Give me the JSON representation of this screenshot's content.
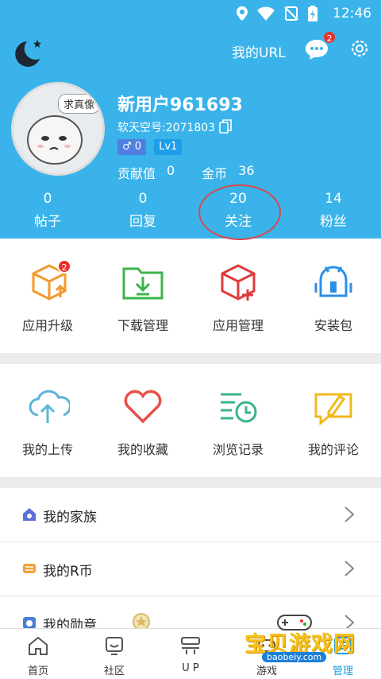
{
  "status_bar": {
    "time": "12:46"
  },
  "header": {
    "my_url_label": "我的URL",
    "message_badge": "2",
    "avatar_bubble_text": "求真像",
    "username": "新用户961693",
    "uid_text": "软天空号:2071803",
    "gender_count": "0",
    "level": "Lv1",
    "contribution_label": "贡献值",
    "contribution_value": "0",
    "coins_label": "金币",
    "coins_value": "36",
    "stats": [
      {
        "num": "0",
        "label": "帖子"
      },
      {
        "num": "0",
        "label": "回复"
      },
      {
        "num": "20",
        "label": "关注"
      },
      {
        "num": "14",
        "label": "粉丝"
      }
    ]
  },
  "grid1": [
    {
      "label": "应用升级",
      "icon": "box-upload-icon",
      "badge": "2",
      "color": "#f39a2c"
    },
    {
      "label": "下载管理",
      "icon": "folder-download-icon",
      "color": "#3cb34a"
    },
    {
      "label": "应用管理",
      "icon": "box-add-icon",
      "color": "#e03a3a"
    },
    {
      "label": "安装包",
      "icon": "android-package-icon",
      "color": "#2b8fe8"
    }
  ],
  "grid2": [
    {
      "label": "我的上传",
      "icon": "cloud-upload-icon",
      "color": "#5ab5d8"
    },
    {
      "label": "我的收藏",
      "icon": "heart-icon",
      "color": "#e8504c"
    },
    {
      "label": "浏览记录",
      "icon": "history-list-icon",
      "color": "#37b48a"
    },
    {
      "label": "我的评论",
      "icon": "comment-edit-icon",
      "color": "#f2b81c"
    }
  ],
  "list": [
    {
      "label": "我的家族",
      "icon": "family-house-icon",
      "color": "#5b6fd6"
    },
    {
      "label": "我的R币",
      "icon": "coin-stack-icon",
      "color": "#f3a23a"
    },
    {
      "label": "我的勋章",
      "icon": "medal-icon",
      "color": "#4a7fd6"
    }
  ],
  "bottom_nav": [
    {
      "label": "首页",
      "icon": "home-icon"
    },
    {
      "label": "社区",
      "icon": "community-icon"
    },
    {
      "label": "U P",
      "icon": "up-icon"
    },
    {
      "label": "游戏",
      "icon": "game-icon"
    },
    {
      "label": "管理",
      "icon": "manage-icon",
      "active": true
    }
  ],
  "watermark": {
    "title": "宝贝游戏网",
    "url": "baobeiy.com"
  }
}
